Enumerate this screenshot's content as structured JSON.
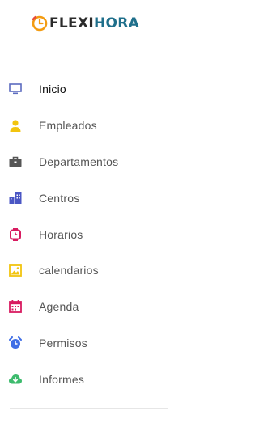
{
  "brand": {
    "part1": "FLEXI",
    "part2": "HORA",
    "mark_color": "#f39c12"
  },
  "menu": {
    "items": [
      {
        "label": "Inicio",
        "icon": "monitor-icon",
        "color": "#5b6bbf",
        "active": true
      },
      {
        "label": "Empleados",
        "icon": "user-icon",
        "color": "#f2c40f",
        "active": false
      },
      {
        "label": "Departamentos",
        "icon": "briefcase-icon",
        "color": "#555555",
        "active": false
      },
      {
        "label": "Centros",
        "icon": "buildings-icon",
        "color": "#4a56c4",
        "active": false
      },
      {
        "label": "Horarios",
        "icon": "watch-icon",
        "color": "#d81b60",
        "active": false
      },
      {
        "label": "calendarios",
        "icon": "image-icon",
        "color": "#f2c40f",
        "active": false
      },
      {
        "label": "Agenda",
        "icon": "calendar-icon",
        "color": "#d81b60",
        "active": false
      },
      {
        "label": "Permisos",
        "icon": "alarm-icon",
        "color": "#3f6ee6",
        "active": false
      },
      {
        "label": "Informes",
        "icon": "cloud-download-icon",
        "color": "#3dbb6d",
        "active": false
      }
    ]
  }
}
